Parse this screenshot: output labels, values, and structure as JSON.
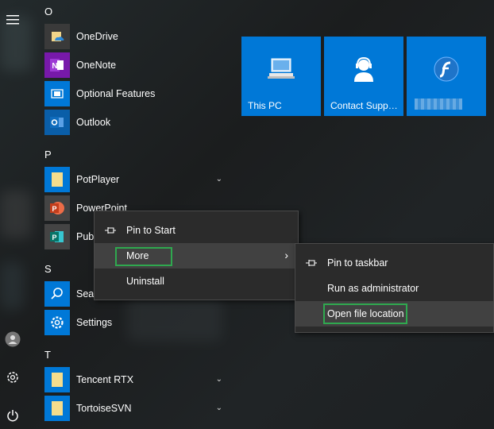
{
  "rail": {
    "icons": [
      "hamburger-icon",
      "user-icon",
      "gear-icon",
      "power-icon"
    ]
  },
  "applist": {
    "groups": [
      {
        "letter": "O"
      },
      {
        "letter": "P"
      },
      {
        "letter": "S"
      },
      {
        "letter": "T"
      }
    ],
    "apps": {
      "onedrive": "OneDrive",
      "onenote": "OneNote",
      "optional_features": "Optional Features",
      "outlook": "Outlook",
      "potplayer": "PotPlayer",
      "powerpoint": "PowerPoint",
      "publisher": "Publ",
      "search": "Sear",
      "settings": "Settings",
      "tencent_rtx": "Tencent RTX",
      "tortoisesvn": "TortoiseSVN"
    }
  },
  "tiles": {
    "this_pc": "This PC",
    "contact_support": "Contact Supp…",
    "flash": "",
    "tile_color": "#0078d7"
  },
  "context_menu": {
    "pin_to_start": "Pin to Start",
    "more": "More",
    "uninstall": "Uninstall"
  },
  "submenu": {
    "pin_to_taskbar": "Pin to taskbar",
    "run_as_admin": "Run as administrator",
    "open_file_location": "Open file location"
  },
  "colors": {
    "highlight": "#2fa84f",
    "menu_bg": "#2b2b2b",
    "hover_bg": "#414141"
  }
}
